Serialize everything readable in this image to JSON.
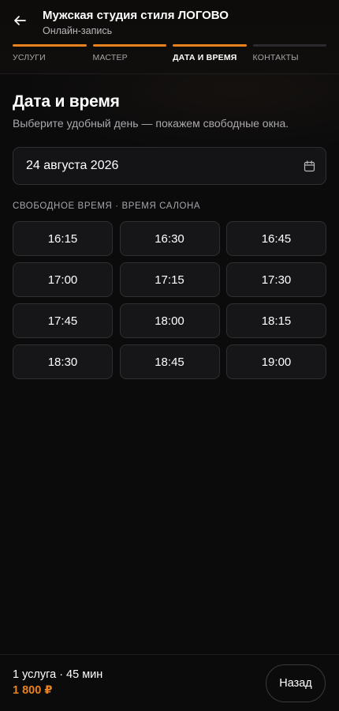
{
  "header": {
    "title": "Мужская студия стиля ЛОГОВО",
    "subtitle": "Онлайн-запись",
    "back_icon": "arrow-left-icon"
  },
  "steps": [
    {
      "label": "Услуги",
      "state": "done"
    },
    {
      "label": "Мастер",
      "state": "done"
    },
    {
      "label": "Дата и время",
      "state": "active"
    },
    {
      "label": "Контакты",
      "state": "pending"
    }
  ],
  "section": {
    "title": "Дата и время",
    "description": "Выберите удобный день — покажем свободные окна."
  },
  "date_field": {
    "value": "24 августа 2026",
    "icon": "calendar-icon"
  },
  "slots_caption": "Свободное время · время салона",
  "slots": [
    "16:15",
    "16:30",
    "16:45",
    "17:00",
    "17:15",
    "17:30",
    "17:45",
    "18:00",
    "18:15",
    "18:30",
    "18:45",
    "19:00"
  ],
  "footer": {
    "summary": "1 услуга · 45 мин",
    "price": "1 800 ₽",
    "back_label": "Назад"
  },
  "colors": {
    "accent": "#e8821f",
    "background": "#0b0b0c",
    "card": "#161618",
    "border": "#2f2f33"
  }
}
